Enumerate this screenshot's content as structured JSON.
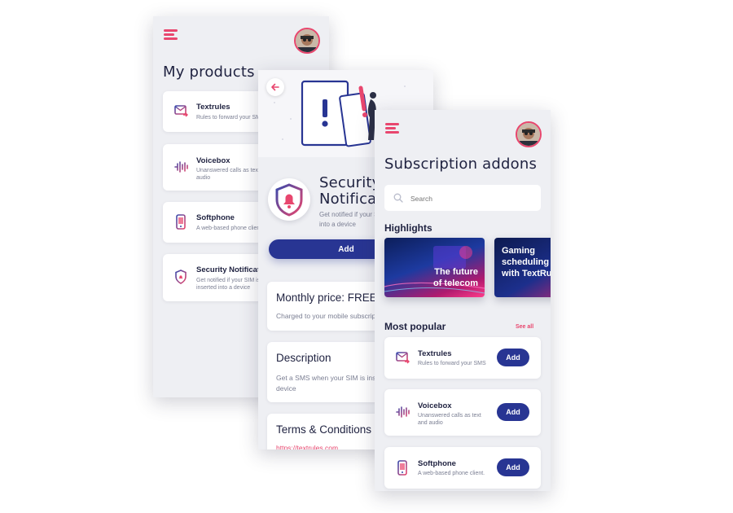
{
  "screen_products": {
    "title": "My products",
    "items": [
      {
        "name": "Textrules",
        "desc": "Rules to forward your SMS",
        "icon": "sms-forward-icon"
      },
      {
        "name": "Voicebox",
        "desc": "Unanswered calls as text and audio",
        "icon": "voice-wave-icon"
      },
      {
        "name": "Softphone",
        "desc": "A web-based phone client.",
        "icon": "phone-icon"
      },
      {
        "name": "Security Notifications",
        "desc": "Get notified if your SIM is inserted into a device",
        "icon": "shield-bell-icon"
      }
    ]
  },
  "screen_detail": {
    "title_line1": "Security",
    "title_line2": "Notifications",
    "desc": "Get notified if your SIM is inserted into a device",
    "add_label": "Add",
    "price_title": "Monthly price: FREE",
    "price_sub": "Charged to your mobile subscription",
    "description_title": "Description",
    "description_text": "Get a SMS when your SIM is inserted into a new device",
    "terms_title": "Terms & Conditions",
    "terms_link": "https://textrules.com"
  },
  "screen_addons": {
    "title": "Subscription addons",
    "search_placeholder": "Search",
    "highlights_label": "Highlights",
    "highlights": [
      {
        "line1": "The future",
        "line2": "of telecom"
      },
      {
        "line1": "Gaming",
        "line2": "scheduling",
        "line3": "with TextRules"
      }
    ],
    "popular_label": "Most popular",
    "see_all": "See all",
    "items": [
      {
        "name": "Textrules",
        "desc": "Rules to forward your SMS",
        "add": "Add",
        "icon": "sms-forward-icon"
      },
      {
        "name": "Voicebox",
        "desc": "Unanswered calls as text and audio",
        "add": "Add",
        "icon": "voice-wave-icon"
      },
      {
        "name": "Softphone",
        "desc": "A web-based phone client.",
        "add": "Add",
        "icon": "phone-icon"
      }
    ]
  },
  "colors": {
    "accent": "#e8466e",
    "primary": "#283593",
    "background": "#eeeff3"
  }
}
